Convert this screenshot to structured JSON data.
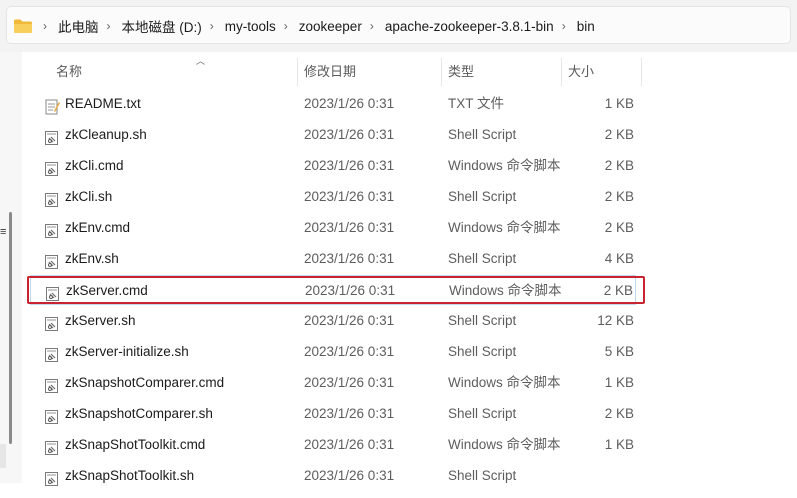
{
  "address_bar": {
    "crumbs": [
      "此电脑",
      "本地磁盘 (D:)",
      "my-tools",
      "zookeeper",
      "apache-zookeeper-3.8.1-bin",
      "bin"
    ]
  },
  "columns": {
    "name": "名称",
    "date": "修改日期",
    "type": "类型",
    "size": "大小"
  },
  "files": [
    {
      "name": "README.txt",
      "date": "2023/1/26 0:31",
      "type": "TXT 文件",
      "size": "1 KB",
      "icon": "text-file-icon"
    },
    {
      "name": "zkCleanup.sh",
      "date": "2023/1/26 0:31",
      "type": "Shell Script",
      "size": "2 KB",
      "icon": "script-file-icon"
    },
    {
      "name": "zkCli.cmd",
      "date": "2023/1/26 0:31",
      "type": "Windows 命令脚本",
      "size": "2 KB",
      "icon": "script-file-icon"
    },
    {
      "name": "zkCli.sh",
      "date": "2023/1/26 0:31",
      "type": "Shell Script",
      "size": "2 KB",
      "icon": "script-file-icon"
    },
    {
      "name": "zkEnv.cmd",
      "date": "2023/1/26 0:31",
      "type": "Windows 命令脚本",
      "size": "2 KB",
      "icon": "script-file-icon"
    },
    {
      "name": "zkEnv.sh",
      "date": "2023/1/26 0:31",
      "type": "Shell Script",
      "size": "4 KB",
      "icon": "script-file-icon"
    },
    {
      "name": "zkServer.cmd",
      "date": "2023/1/26 0:31",
      "type": "Windows 命令脚本",
      "size": "2 KB",
      "icon": "script-file-icon",
      "selected": true
    },
    {
      "name": "zkServer.sh",
      "date": "2023/1/26 0:31",
      "type": "Shell Script",
      "size": "12 KB",
      "icon": "script-file-icon"
    },
    {
      "name": "zkServer-initialize.sh",
      "date": "2023/1/26 0:31",
      "type": "Shell Script",
      "size": "5 KB",
      "icon": "script-file-icon"
    },
    {
      "name": "zkSnapshotComparer.cmd",
      "date": "2023/1/26 0:31",
      "type": "Windows 命令脚本",
      "size": "1 KB",
      "icon": "script-file-icon"
    },
    {
      "name": "zkSnapshotComparer.sh",
      "date": "2023/1/26 0:31",
      "type": "Shell Script",
      "size": "2 KB",
      "icon": "script-file-icon"
    },
    {
      "name": "zkSnapShotToolkit.cmd",
      "date": "2023/1/26 0:31",
      "type": "Windows 命令脚本",
      "size": "1 KB",
      "icon": "script-file-icon"
    },
    {
      "name": "zkSnapShotToolkit.sh",
      "date": "2023/1/26 0:31",
      "type": "Shell Script",
      "size": "",
      "icon": "script-file-icon"
    }
  ],
  "colors": {
    "highlight": "#c8242f",
    "folder": "#f4c542"
  }
}
